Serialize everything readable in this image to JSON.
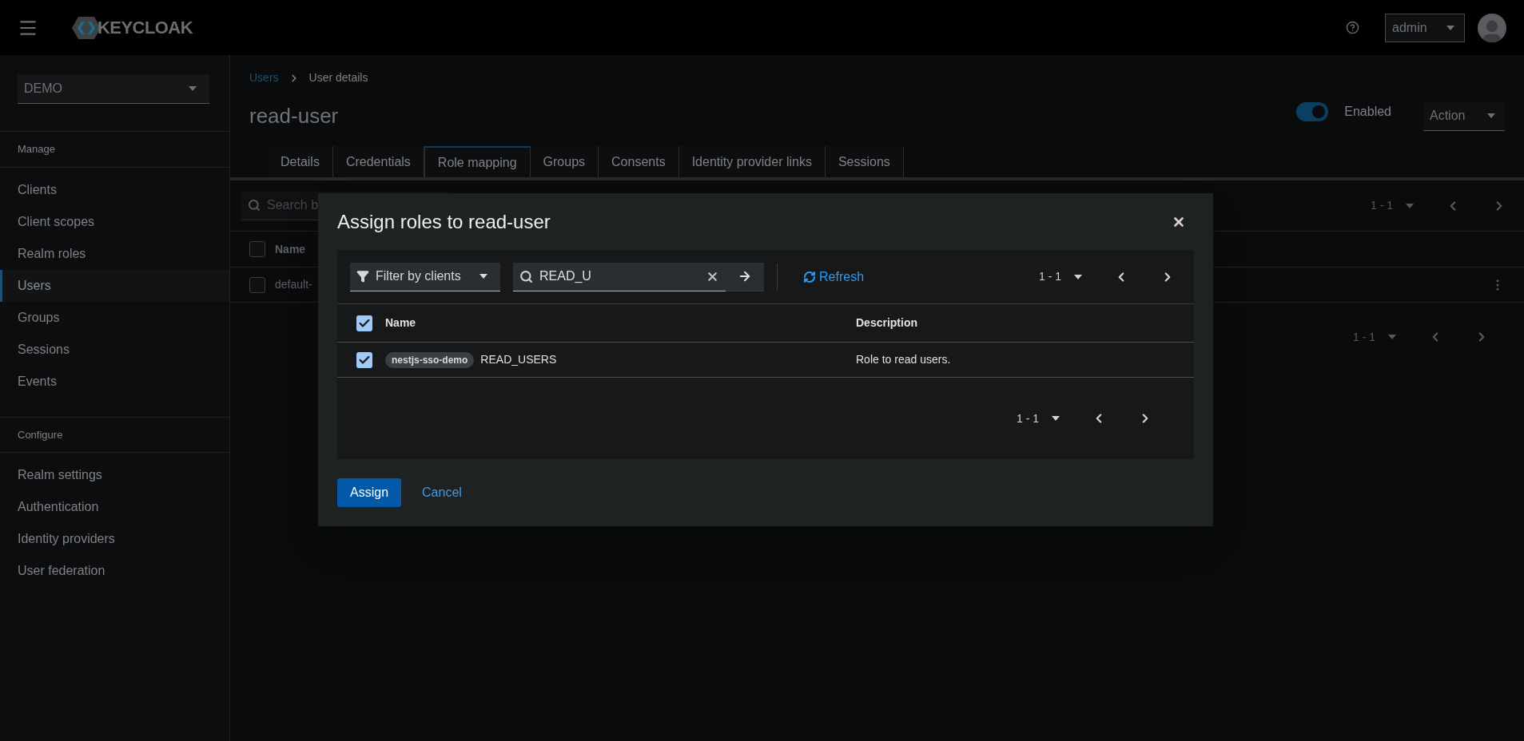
{
  "header": {
    "logo": "KEYCLOAK",
    "user_menu": "admin"
  },
  "sidebar": {
    "realm": "DEMO",
    "sections": [
      {
        "title": "Manage",
        "items": [
          {
            "label": "Clients",
            "selected": false
          },
          {
            "label": "Client scopes",
            "selected": false
          },
          {
            "label": "Realm roles",
            "selected": false
          },
          {
            "label": "Users",
            "selected": true
          },
          {
            "label": "Groups",
            "selected": false
          },
          {
            "label": "Sessions",
            "selected": false
          },
          {
            "label": "Events",
            "selected": false
          }
        ]
      },
      {
        "title": "Configure",
        "items": [
          {
            "label": "Realm settings",
            "selected": false
          },
          {
            "label": "Authentication",
            "selected": false
          },
          {
            "label": "Identity providers",
            "selected": false
          },
          {
            "label": "User federation",
            "selected": false
          }
        ]
      }
    ]
  },
  "breadcrumb": {
    "link": "Users",
    "current": "User details"
  },
  "page_title": "read-user",
  "enabled_switch": {
    "label": "Enabled",
    "on": true
  },
  "action_menu": "Action",
  "tabs": [
    {
      "label": "Details",
      "selected": false
    },
    {
      "label": "Credentials",
      "selected": false
    },
    {
      "label": "Role mapping",
      "selected": true
    },
    {
      "label": "Groups",
      "selected": false
    },
    {
      "label": "Consents",
      "selected": false
    },
    {
      "label": "Identity provider links",
      "selected": false
    },
    {
      "label": "Sessions",
      "selected": false
    }
  ],
  "background_table": {
    "search_placeholder": "Search b",
    "pagination_top": "1 - 1",
    "column": "Name",
    "header_checked": false,
    "rows": [
      {
        "name": "default-",
        "checked": false
      }
    ],
    "pagination_bottom": "1 - 1"
  },
  "modal": {
    "title": "Assign roles to read-user",
    "filter": "Filter by clients",
    "search_value": "READ_U",
    "refresh": "Refresh",
    "pagination_top": "1 - 1",
    "columns": [
      "Name",
      "Description"
    ],
    "header_checked": true,
    "rows": [
      {
        "client": "nestjs-sso-demo",
        "role": "READ_USERS",
        "description": "Role to read users.",
        "checked": true
      }
    ],
    "pagination_bottom": "1 - 1",
    "buttons": {
      "primary": "Assign",
      "link": "Cancel"
    }
  }
}
